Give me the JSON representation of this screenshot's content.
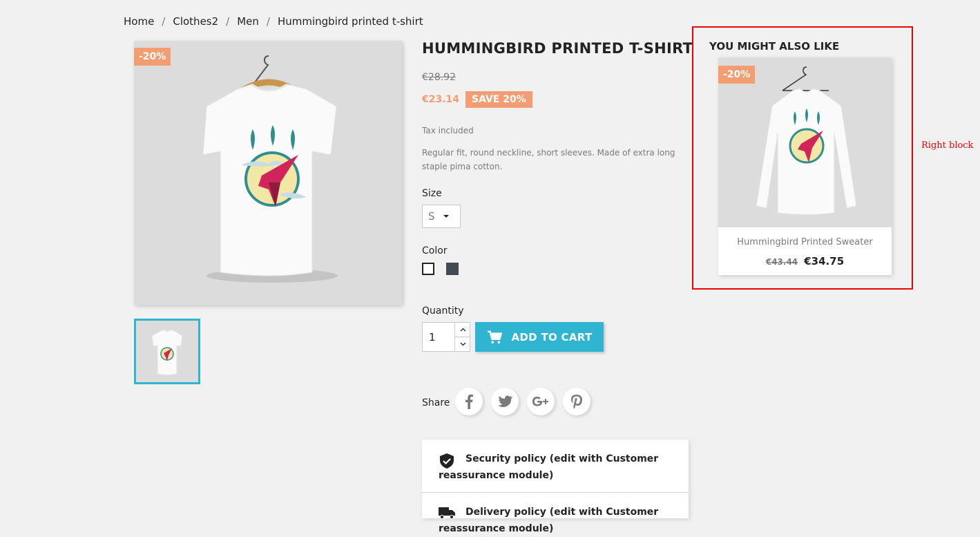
{
  "breadcrumb": {
    "items": [
      "Home",
      "Clothes2",
      "Men",
      "Hummingbird printed t-shirt"
    ],
    "separator": "/"
  },
  "gallery": {
    "discount_badge": "-20%"
  },
  "product": {
    "title": "HUMMINGBIRD PRINTED T-SHIRT",
    "old_price": "€28.92",
    "price": "€23.14",
    "save_badge": "SAVE 20%",
    "tax_label": "Tax included",
    "description": "Regular fit, round neckline, short sleeves. Made of extra long staple pima cotton.",
    "size_label": "Size",
    "size_value": "S",
    "color_label": "Color",
    "colors": [
      "#ffffff",
      "#434a54"
    ],
    "quantity_label": "Quantity",
    "quantity_value": "1",
    "add_to_cart": "ADD TO CART",
    "share_label": "Share",
    "share_icons": [
      "facebook-icon",
      "twitter-icon",
      "google-plus-icon",
      "pinterest-icon"
    ]
  },
  "reassurance": {
    "items": [
      {
        "icon": "shield-check-icon",
        "text": "Security policy (edit with Customer reassurance module)"
      },
      {
        "icon": "truck-icon",
        "text": "Delivery policy (edit with Customer reassurance module)"
      }
    ]
  },
  "sidebar": {
    "heading": "YOU MIGHT ALSO LIKE",
    "card": {
      "badge": "-20%",
      "name": "Hummingbird Printed Sweater",
      "old_price": "€43.44",
      "price": "€34.75"
    }
  },
  "annotation": {
    "label": "Right block",
    "color": "#e00000"
  },
  "colors": {
    "accent": "#2fb5d2",
    "discount": "#f39d72",
    "background": "#f1f1f1"
  }
}
